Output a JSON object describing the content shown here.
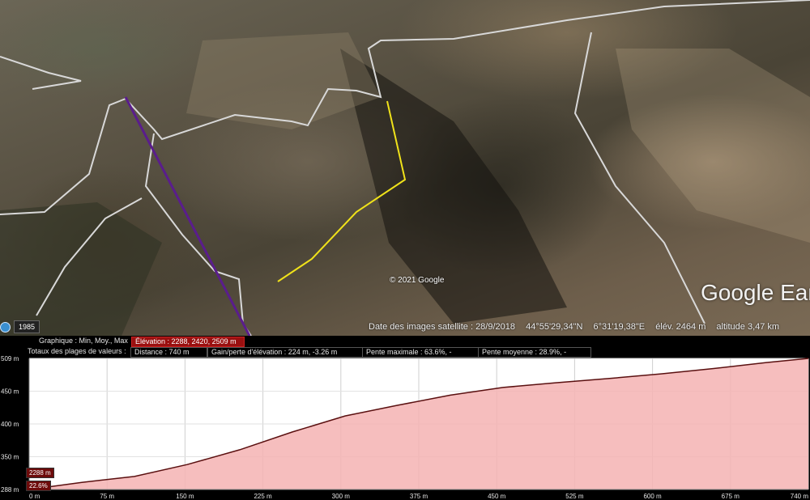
{
  "map": {
    "copyright": "© 2021 Google",
    "logo": "Google Earth",
    "historical_year": "1985",
    "status": {
      "imagery_date": "Date des images satellite : 28/9/2018",
      "latitude": "44°55'29,34\"N",
      "longitude": "6°31'19,38\"E",
      "elevation": "élév. 2464 m",
      "altitude": "altitude  3,47 km"
    },
    "colors": {
      "track": "#f0e21a",
      "cable_line": "#5a1d8c",
      "trails": "#d8d8d8"
    }
  },
  "profile": {
    "graph_label": "Graphique : Min, Moy., Max",
    "graph_value": "Élévation : 2288, 2420, 2509 m",
    "totals_label": "Totaux des plages de valeurs :",
    "distance": "Distance : 740 m",
    "gain": "Gain/perte d'élévation : 224 m, -3.26 m",
    "max_slope": "Pente maximale : 63.6%, -",
    "avg_slope": "Pente moyenne : 28.9%, -",
    "current_elevation": "2288 m",
    "current_slope": "22.6%",
    "colors": {
      "line": "#5a1010",
      "fill": "#f5b3b3"
    }
  },
  "chart_data": {
    "type": "area",
    "title": "",
    "xlabel": "",
    "ylabel": "",
    "x_tick_labels": [
      "0 m",
      "75 m",
      "150 m",
      "225 m",
      "300 m",
      "375 m",
      "450 m",
      "525 m",
      "600 m",
      "675 m",
      "740 m"
    ],
    "y_tick_labels": [
      "288 m",
      "350 m",
      "400 m",
      "450 m",
      "509 m"
    ],
    "x": [
      0,
      50,
      100,
      150,
      200,
      250,
      300,
      350,
      400,
      450,
      500,
      550,
      600,
      650,
      700,
      740
    ],
    "y": [
      2288,
      2300,
      2310,
      2330,
      2355,
      2385,
      2412,
      2430,
      2447,
      2460,
      2468,
      2475,
      2483,
      2492,
      2502,
      2509
    ],
    "xlim": [
      0,
      740
    ],
    "ylim": [
      2288,
      2509
    ],
    "grid": true
  }
}
